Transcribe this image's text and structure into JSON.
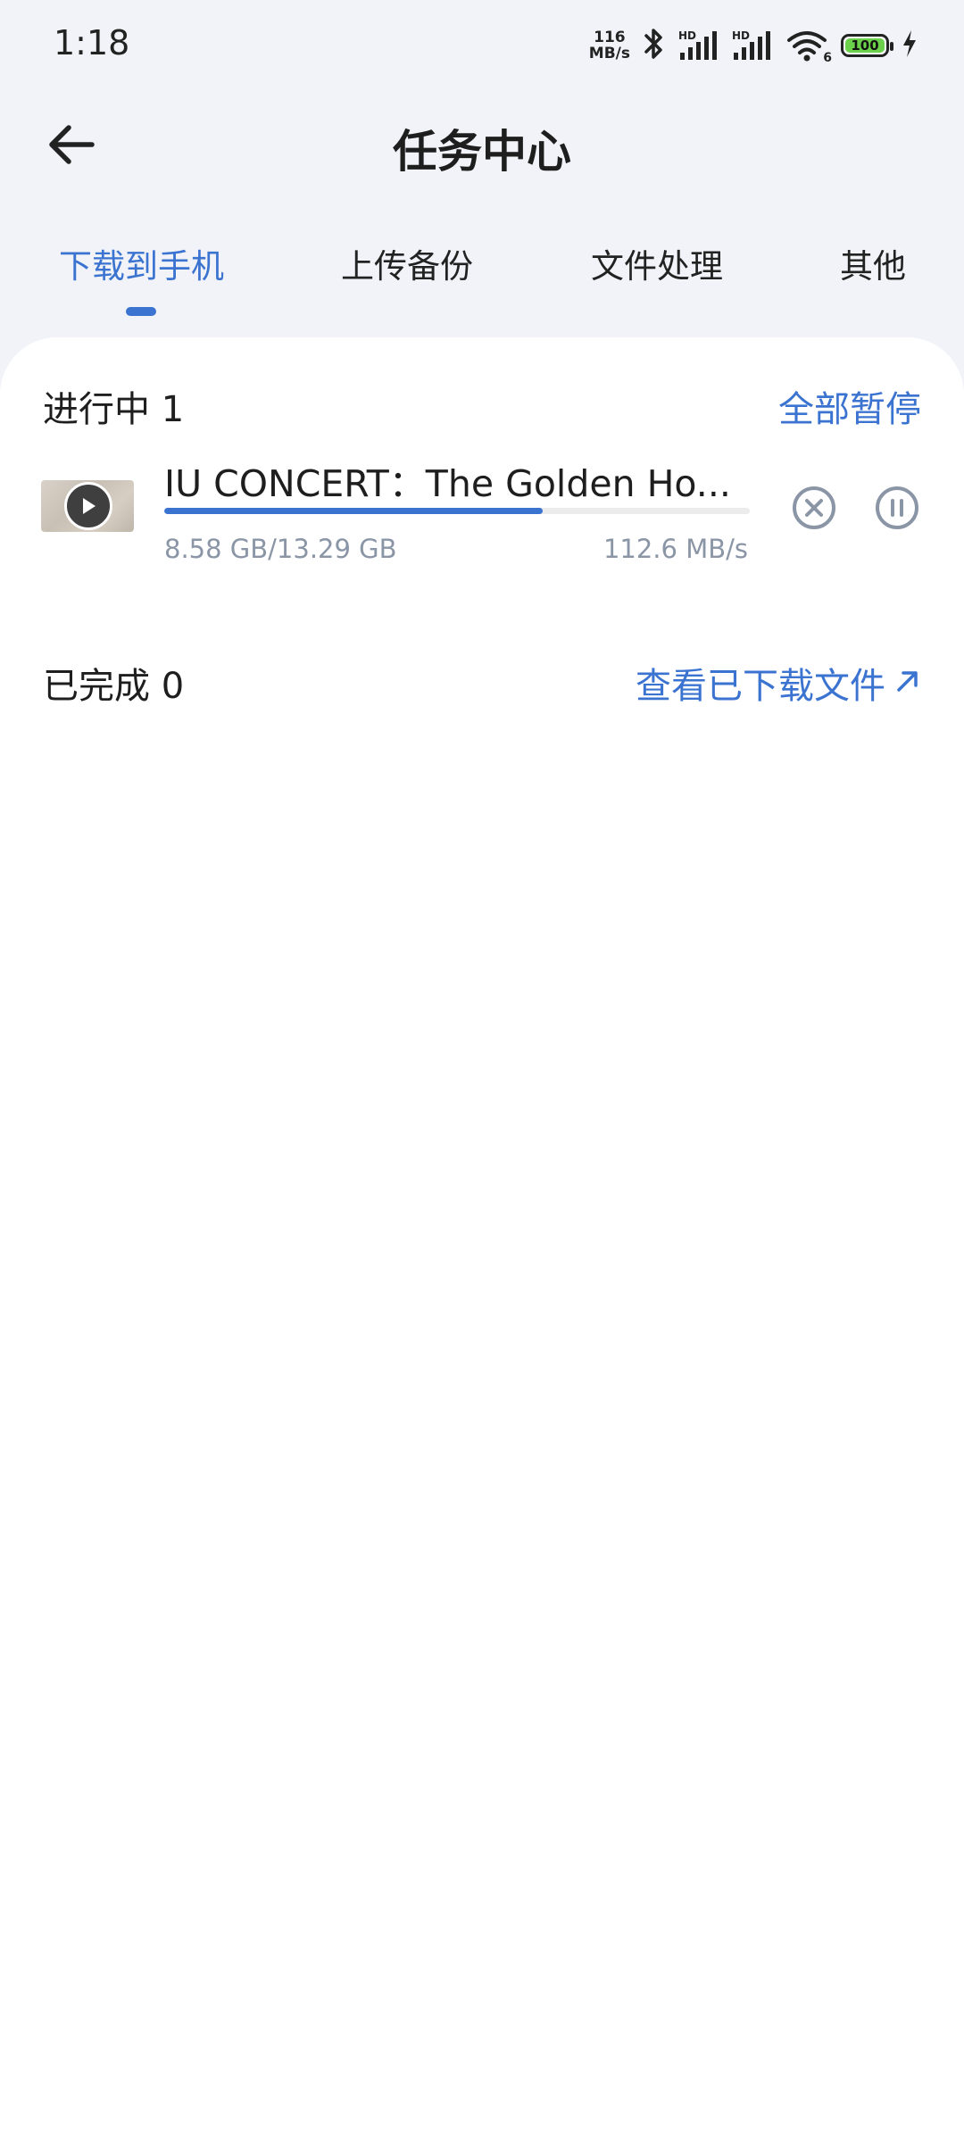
{
  "status_bar": {
    "time": "1:18",
    "net_speed_value": "116",
    "net_speed_unit": "MB/s",
    "sim1_label": "HD",
    "sim2_label": "HD",
    "wifi_sub": "6",
    "battery_level": "100"
  },
  "header": {
    "title": "任务中心"
  },
  "tabs": [
    {
      "label": "下载到手机",
      "active": true
    },
    {
      "label": "上传备份",
      "active": false
    },
    {
      "label": "文件处理",
      "active": false
    },
    {
      "label": "其他",
      "active": false
    }
  ],
  "in_progress": {
    "label": "进行中 1",
    "action_label": "全部暂停",
    "tasks": [
      {
        "name": "IU CONCERT：The Golden Ho...",
        "size_text": "8.58 GB/13.29 GB",
        "speed_text": "112.6 MB/s",
        "progress": 0.646
      }
    ]
  },
  "completed": {
    "label": "已完成 0",
    "action_label": "查看已下载文件"
  },
  "colors": {
    "accent": "#3B73D1",
    "background": "#F1F3F8",
    "card": "#FFFFFF",
    "secondary_text": "#8A95A6"
  },
  "icons": {
    "back": "arrow-left-icon",
    "cancel": "close-circle-icon",
    "pause": "pause-circle-icon",
    "external": "arrow-up-right-icon",
    "play": "play-icon"
  }
}
